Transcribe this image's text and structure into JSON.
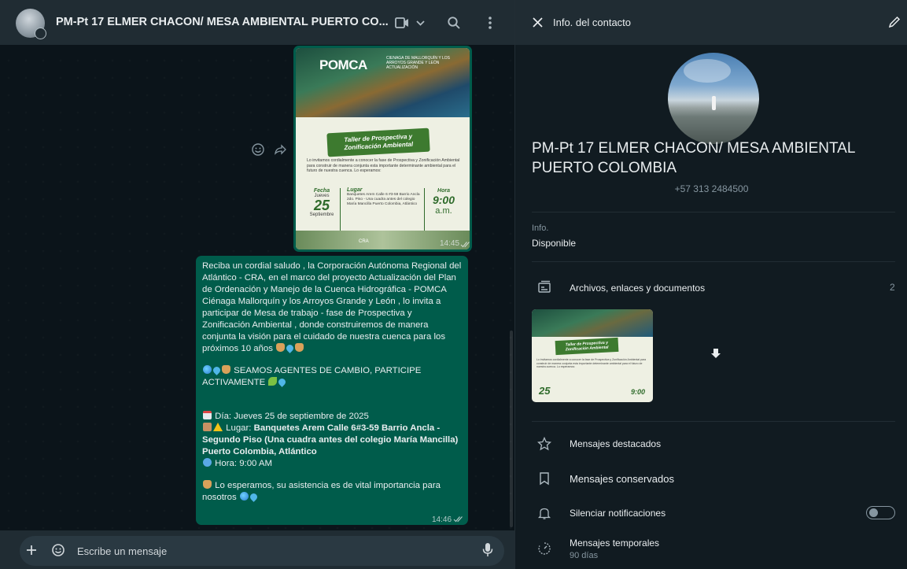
{
  "chat": {
    "title": "PM-Pt 17 ELMER CHACON/ MESA AMBIENTAL PUERTO CO...",
    "image_message": {
      "time": "14:45",
      "poster": {
        "brand": "POMCA",
        "header_text": "CIENAGA DE MALLORQUÍN Y LOS ARROYOS GRANDE Y LEÓN ACTUALIZACIÓN",
        "banner": "Taller de Prospectiva y Zonificación Ambiental",
        "body": "Lo invitamos cordialmente a conocer la fase de Prospectiva y Zonificación Ambiental para construir de manera conjunta esta importante determinante ambiental para el futuro de nuestra cuenca. Lo esperamos:",
        "fecha_label": "Fecha",
        "fecha_day": "Jueves",
        "fecha_num": "25",
        "fecha_month": "Septiembre",
        "lugar_label": "Lugar",
        "lugar_text": "Banquetes Arem Calle 6 #3-59 Barrio Ancla 2do. Piso - Una cuadra antes del colegio María Mancilla Puerto Colombia, Atlántico",
        "hora_label": "Hora",
        "hora_value": "9:00",
        "hora_ampm": "a.m.",
        "org": "CRA"
      }
    },
    "text_message": {
      "time": "14:46",
      "p1": "Reciba un cordial saludo , la Corporación Autónoma Regional del Atlántico  - CRA, en el marco del proyecto   Actualización del Plan de Ordenación y Manejo de la Cuenca Hidrográfica - POMCA Ciénaga Mallorquín y los Arroyos Grande y León  , lo invita a participar de  Mesa de trabajo - fase de Prospectiva y Zonificación Ambiental , donde construiremos de manera conjunta la visión para el cuidado de nuestra cuenca para los  próximos 10 años",
      "p2": "SEAMOS AGENTES DE CAMBIO, PARTICIPE ACTIVAMENTE",
      "dia": "Día: Jueves 25 de septiembre de 2025",
      "lugar_label": "Lugar:",
      "lugar_value": "Banquetes Arem Calle 6#3-59 Barrio Ancla - Segundo Piso (Una cuadra antes del colegio María Mancilla) Puerto Colombia, Atlántico",
      "hora": "Hora: 9:00 AM",
      "closing": "Lo esperamos, su asistencia es de vital importancia para nosotros"
    },
    "input_placeholder": "Escribe un mensaje"
  },
  "info": {
    "header_title": "Info. del contacto",
    "name": "PM-Pt 17 ELMER CHACON/ MESA AMBIENTAL PUERTO COLOMBIA",
    "phone": "+57 313 2484500",
    "about_label": "Info.",
    "about_value": "Disponible",
    "media_label": "Archivos, enlaces y documentos",
    "media_count": "2",
    "thumb": {
      "banner": "Taller de Prospectiva y Zonificación Ambiental",
      "body": "Lo invitamos cordialmente a conocer la fase de Prospectiva y Zonificación Ambiental para construir de manera conjunta esta importante determinante ambiental para el futuro de nuestra cuenca. Lo esperamos:",
      "fecha_num": "25",
      "hora_value": "9:00"
    },
    "starred_label": "Mensajes destacados",
    "kept_label": "Mensajes conservados",
    "mute_label": "Silenciar notificaciones",
    "mute_on": false,
    "temp_label": "Mensajes temporales",
    "temp_value": "90 días"
  },
  "colors": {
    "bubble_out": "#005c4b",
    "panel": "#202c33",
    "background": "#0b141a"
  }
}
